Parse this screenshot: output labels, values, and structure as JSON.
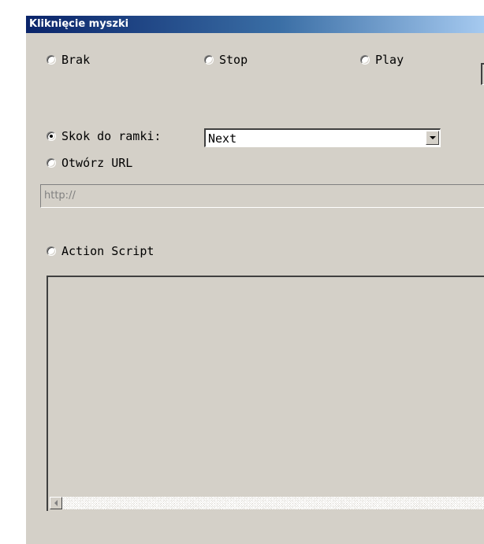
{
  "window": {
    "title": "Kliknięcie myszki"
  },
  "options": {
    "brak": {
      "label": "Brak",
      "checked": false
    },
    "stop": {
      "label": "Stop",
      "checked": false
    },
    "play": {
      "label": "Play",
      "checked": false
    },
    "skok": {
      "label": "Skok do ramki:",
      "checked": true
    },
    "url": {
      "label": "Otwórz URL",
      "checked": false
    },
    "script": {
      "label": "Action Script",
      "checked": false
    }
  },
  "frame_select": {
    "value": "Next"
  },
  "url_field": {
    "placeholder": "http://",
    "value": ""
  },
  "script_editor": {
    "value": ""
  }
}
